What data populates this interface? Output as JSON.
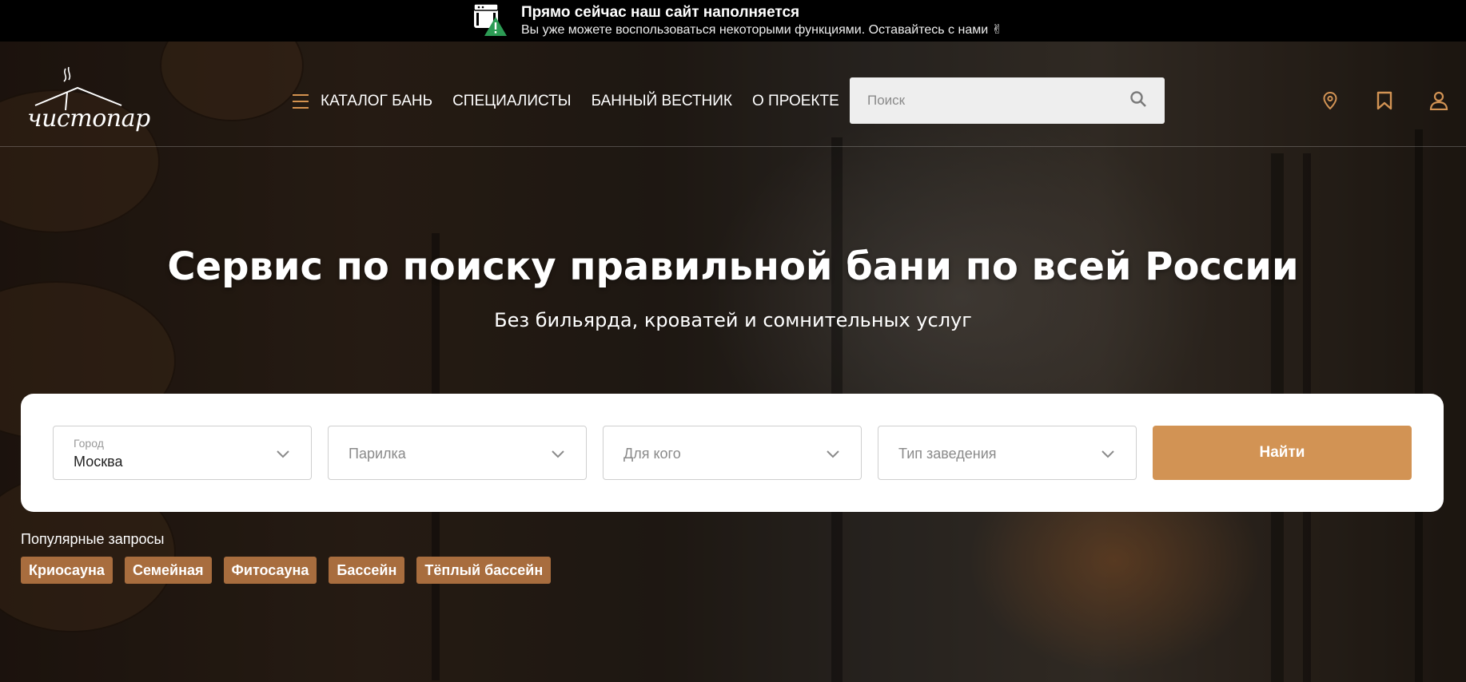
{
  "notice": {
    "title": "Прямо сейчас наш сайт наполняется",
    "subtitle": "Вы уже можете воспользоваться некоторыми функциями. Оставайтесь с нами ✌"
  },
  "header": {
    "logo_text": "чистопар",
    "nav": [
      {
        "label": "КАТАЛОГ БАНЬ"
      },
      {
        "label": "СПЕЦИАЛИСТЫ"
      },
      {
        "label": "БАННЫЙ ВЕСТНИК"
      },
      {
        "label": "О ПРОЕКТЕ"
      }
    ],
    "search_placeholder": "Поиск",
    "icons": [
      "map-pin-icon",
      "bookmark-icon",
      "user-icon"
    ]
  },
  "hero": {
    "title": "Сервис по поиску правильной бани по всей России",
    "subtitle": "Без бильярда, кроватей и сомнительных услуг"
  },
  "filters": {
    "city_label": "Город",
    "city_value": "Москва",
    "steam_placeholder": "Парилка",
    "for_whom_placeholder": "Для кого",
    "type_placeholder": "Тип заведения",
    "find_label": "Найти"
  },
  "popular": {
    "label": "Популярные запросы",
    "tags": [
      "Криосауна",
      "Семейная",
      "Фитосауна",
      "Бассейн",
      "Тёплый бассейн"
    ]
  },
  "colors": {
    "accent": "#d29354",
    "tag_bg": "#a86d3e",
    "notice_bg": "#000000"
  }
}
